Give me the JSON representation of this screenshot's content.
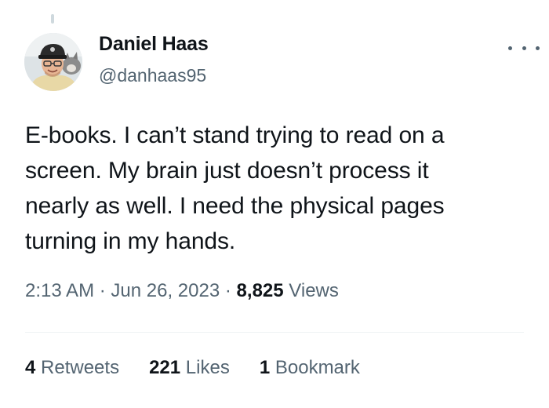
{
  "author": {
    "name": "Daniel Haas",
    "handle": "@danhaas95"
  },
  "tweet": {
    "text_lines": [
      "E-books. I can’t stand trying to read on a",
      "screen. My brain just doesn’t process it",
      "nearly as well. I need the physical pages",
      "turning in my hands."
    ]
  },
  "meta": {
    "time": "2:13 AM",
    "separator": "·",
    "date": "Jun 26, 2023",
    "views_count": "8,825",
    "views_label": "Views"
  },
  "stats": {
    "retweets_count": "4",
    "retweets_label": "Retweets",
    "likes_count": "221",
    "likes_label": "Likes",
    "bookmarks_count": "1",
    "bookmarks_label": "Bookmark"
  },
  "icons": {
    "more": "more-horizontal-icon",
    "avatar": "profile-photo"
  },
  "colors": {
    "text": "#0f1419",
    "secondary": "#536471",
    "divider": "#eff3f4"
  }
}
